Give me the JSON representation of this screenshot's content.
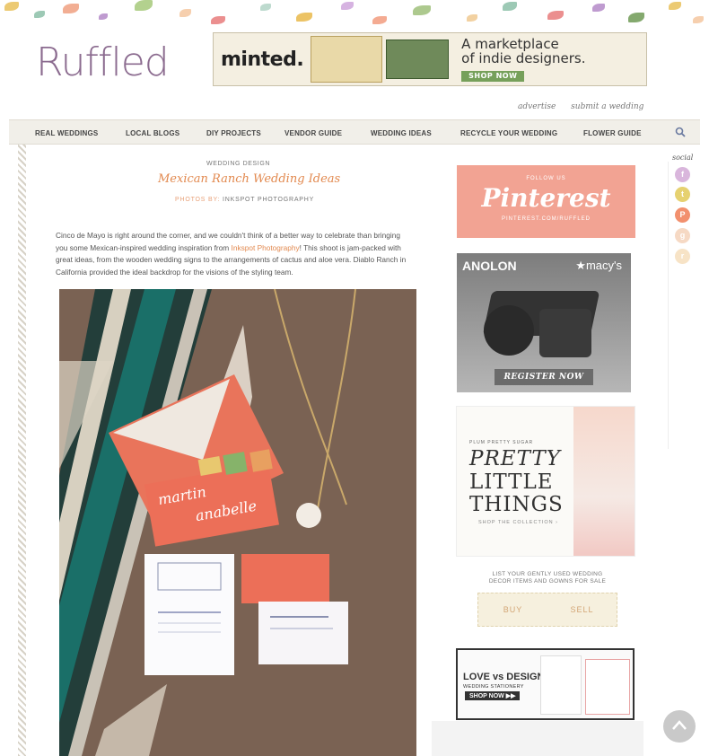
{
  "site": {
    "logo": "Ruffled"
  },
  "ad_top": {
    "brand": "minted.",
    "tagline_1": "A marketplace",
    "tagline_2": "of indie designers.",
    "cta": "SHOP NOW"
  },
  "utility": {
    "advertise": "advertise",
    "submit": "submit a wedding"
  },
  "nav": {
    "items": [
      "REAL WEDDINGS",
      "LOCAL BLOGS",
      "DIY PROJECTS",
      "VENDOR GUIDE",
      "WEDDING IDEAS",
      "RECYCLE YOUR WEDDING",
      "FLOWER GUIDE"
    ]
  },
  "article": {
    "category": "WEDDING DESIGN",
    "title": "Mexican Ranch Wedding Ideas",
    "photos_by_label": "PHOTOS BY:",
    "photographer": "INKSPOT PHOTOGRAPHY",
    "body_part1": "Cinco de Mayo is right around the corner, and we couldn't think of a better way to celebrate than bringing you some Mexican-inspired wedding inspiration from ",
    "body_link": "Inkspot Photography",
    "body_part2": "! This shoot is jam-packed with great ideas, from the wooden wedding signs to the arrangements of cactus and aloe vera. Diablo Ranch in California provided the ideal backdrop for the visions of the styling team."
  },
  "sidebar": {
    "pinterest": {
      "follow": "FOLLOW US",
      "word": "Pinterest",
      "url": "PINTEREST.COM/RUFFLED"
    },
    "anolon": {
      "brand": "ANOLON",
      "store": "★macy's",
      "cta": "REGISTER NOW"
    },
    "pps": {
      "brand": "PLUM PRETTY SUGAR",
      "line1": "PRETTY",
      "line2": "LITTLE",
      "line3": "THINGS",
      "shop": "SHOP THE COLLECTION ›"
    },
    "recycle": {
      "line1": "LIST YOUR GENTLY USED WEDDING",
      "line2": "DECOR ITEMS AND GOWNS FOR SALE",
      "buy": "BUY",
      "sell": "SELL"
    },
    "lovedesign": {
      "title": "LOVE vs DESIGN",
      "sub": "WEDDING STATIONERY",
      "cta": "SHOP NOW ▶▶"
    }
  },
  "social": {
    "label": "social"
  },
  "colors": {
    "accent": "#e2894f",
    "nav_bg": "#f1efe9",
    "pinterest": "#f2a393"
  }
}
